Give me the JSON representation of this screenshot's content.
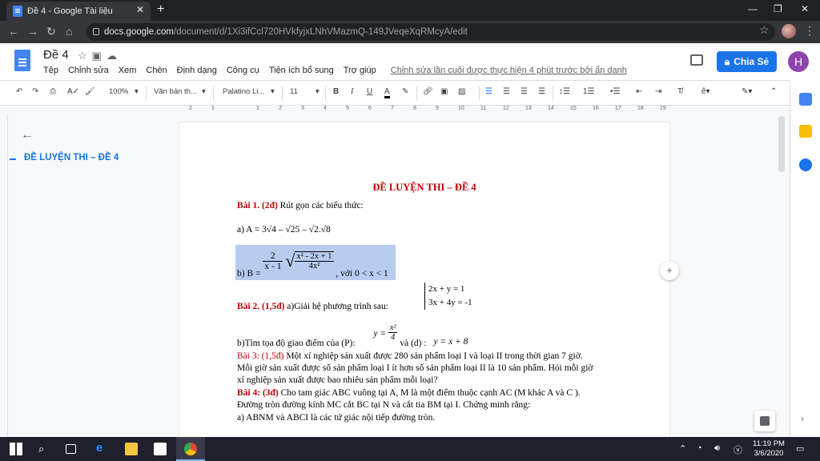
{
  "browser": {
    "tab_title": "Đề 4 - Google Tài liệu",
    "url_host": "docs.google.com",
    "url_path": "/document/d/1Xi3ifCcl720HVkfyjxLNhVMazmQ-149JVeqeXqRMcyA/edit"
  },
  "docs": {
    "doc_title": "Đề 4",
    "menu": [
      "Tệp",
      "Chỉnh sửa",
      "Xem",
      "Chèn",
      "Định dạng",
      "Công cụ",
      "Tiện ích bổ sung",
      "Trợ giúp"
    ],
    "last_edit": "Chỉnh sửa lần cuối được thực hiện 4 phút trước bởi ẩn danh",
    "share_label": "Chia Sẻ",
    "user_initial": "H"
  },
  "toolbar": {
    "zoom": "100%",
    "style": "Văn bản th...",
    "font": "Palatino Li...",
    "size": "11"
  },
  "ruler": [
    "2",
    "1",
    "1",
    "2",
    "3",
    "4",
    "5",
    "6",
    "7",
    "8",
    "9",
    "10",
    "11",
    "12",
    "13",
    "14",
    "15",
    "16",
    "17",
    "18",
    "19"
  ],
  "outline": {
    "item": "ĐỀ LUYỆN THI – ĐỀ 4"
  },
  "page": {
    "title": "ĐỀ LUYỆN THI – ĐỀ 4",
    "b1_label": "Bài 1. (2đ)",
    "b1_text": " Rút gọn các biểu thức:",
    "a_label": "a) A = ",
    "a_expr": "3√4 – √25 – √2.√8",
    "b_label": "b) B = ",
    "b_frac_num": "2",
    "b_frac_den": "x - 1",
    "b_sqrt_num": "x² - 2x + 1",
    "b_sqrt_den": "4x²",
    "b_cond": ", với 0 < x < 1",
    "sys_line1": "2x + y = 1",
    "sys_line2": "3x + 4y = -1",
    "b2_label": "Bài 2. (1,5đ)",
    "b2_text": " a)Giải   hệ phương trình sau:",
    "b2b_text": "b)Tìm tọa độ giao điểm của (P):",
    "p_lhs": "y =",
    "p_num": "x²",
    "p_den": "4",
    "d_text": " và (d) :",
    "d_expr": "y = x + 8",
    "b3_label": "Bài 3: (1,5đ)",
    "b3_text1": " Một xí nghiệp sản xuất được 280 sản phẩm loại I và loại II trong thời gian 7 giờ.",
    "b3_text2": "Mỗi giờ sản xuất được số sản phẩm loại I ít hơn số sản phẩm loại II là 10 sản phẩm. Hỏi mỗi giờ",
    "b3_text3": "xí nghiệp sản xuất được bao nhiêu sản phẩm mỗi loại?",
    "b4_label": "Bài 4: (3đ)",
    "b4_text1": " Cho tam giác ABC vuông tại A, M là một điểm thuộc cạnh AC (M khác A và C ).",
    "b4_text2": "Đường tròn đường kính MC cắt BC tại N và cắt tia BM tại I. Chứng minh rằng:",
    "b4_text3": "a) ABNM và ABCI là các tứ giác nội tiếp đường tròn."
  },
  "taskbar": {
    "time": "11:19 PM",
    "date": "3/6/2020"
  }
}
